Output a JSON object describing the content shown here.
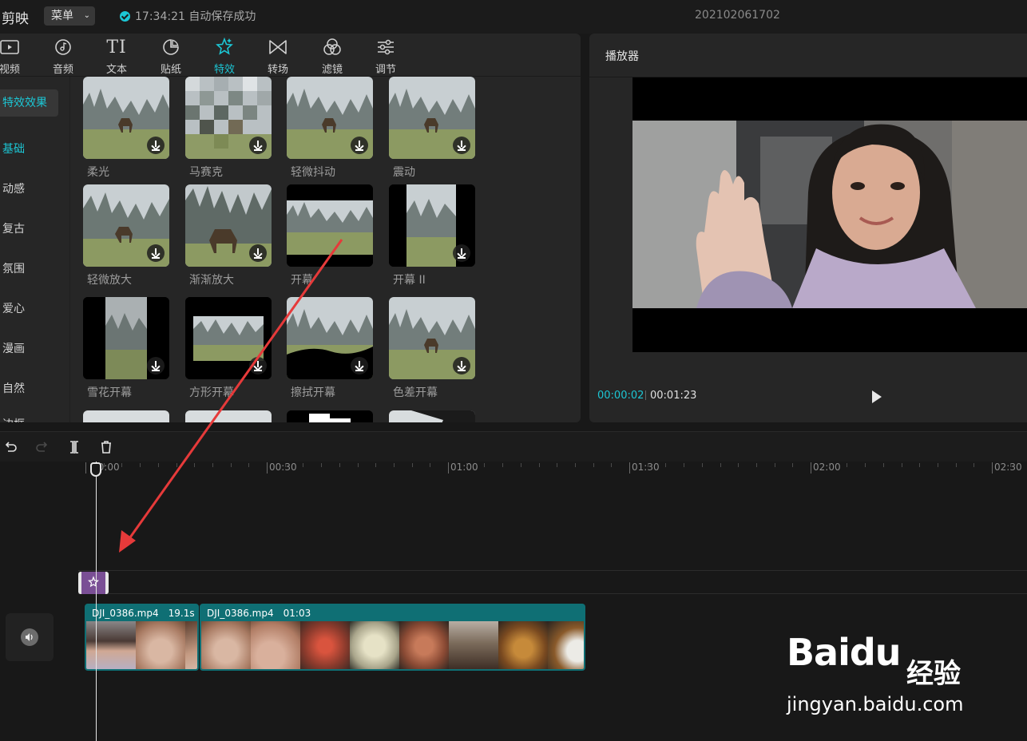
{
  "topbar": {
    "app_name": "剪映",
    "menu_label": "菜单",
    "save_status": "17:34:21 自动保存成功",
    "project_name": "202102061702"
  },
  "tool_tabs": [
    {
      "label": "视频",
      "icon": "video-icon"
    },
    {
      "label": "音频",
      "icon": "audio-icon"
    },
    {
      "label": "文本",
      "icon": "text-icon"
    },
    {
      "label": "贴纸",
      "icon": "sticker-icon"
    },
    {
      "label": "特效",
      "icon": "effects-icon",
      "active": true
    },
    {
      "label": "转场",
      "icon": "transition-icon"
    },
    {
      "label": "滤镜",
      "icon": "filter-icon"
    },
    {
      "label": "调节",
      "icon": "adjust-icon"
    }
  ],
  "categories": {
    "header": "特效效果",
    "items": [
      "基础",
      "动感",
      "复古",
      "氛围",
      "爱心",
      "漫画",
      "自然",
      "边框"
    ]
  },
  "effects": [
    {
      "label": "柔光"
    },
    {
      "label": "马赛克"
    },
    {
      "label": "轻微抖动"
    },
    {
      "label": "震动"
    },
    {
      "label": "轻微放大"
    },
    {
      "label": "渐渐放大"
    },
    {
      "label": "开幕"
    },
    {
      "label": "开幕 II"
    },
    {
      "label": "雪花开幕"
    },
    {
      "label": "方形开幕"
    },
    {
      "label": "擦拭开幕"
    },
    {
      "label": "色差开幕"
    }
  ],
  "player": {
    "title": "播放器",
    "current_time": "00:00:02",
    "total_time": "00:01:23"
  },
  "timeline": {
    "ruler_labels": [
      "00:00",
      "00:30",
      "01:00",
      "01:30",
      "02:00",
      "02:30"
    ],
    "clips": [
      {
        "name": "DJI_0386.mp4",
        "duration": "19.1s"
      },
      {
        "name": "DJI_0386.mp4",
        "duration": "01:03"
      }
    ]
  },
  "watermark": {
    "logo_text": "Baidu",
    "cn_text": "经验",
    "url": "jingyan.baidu.com"
  },
  "colors": {
    "accent": "#1cc6d4",
    "effect_clip": "#7a4f95",
    "video_clip": "#0f6f74",
    "annotation_arrow": "#e63a3a"
  }
}
